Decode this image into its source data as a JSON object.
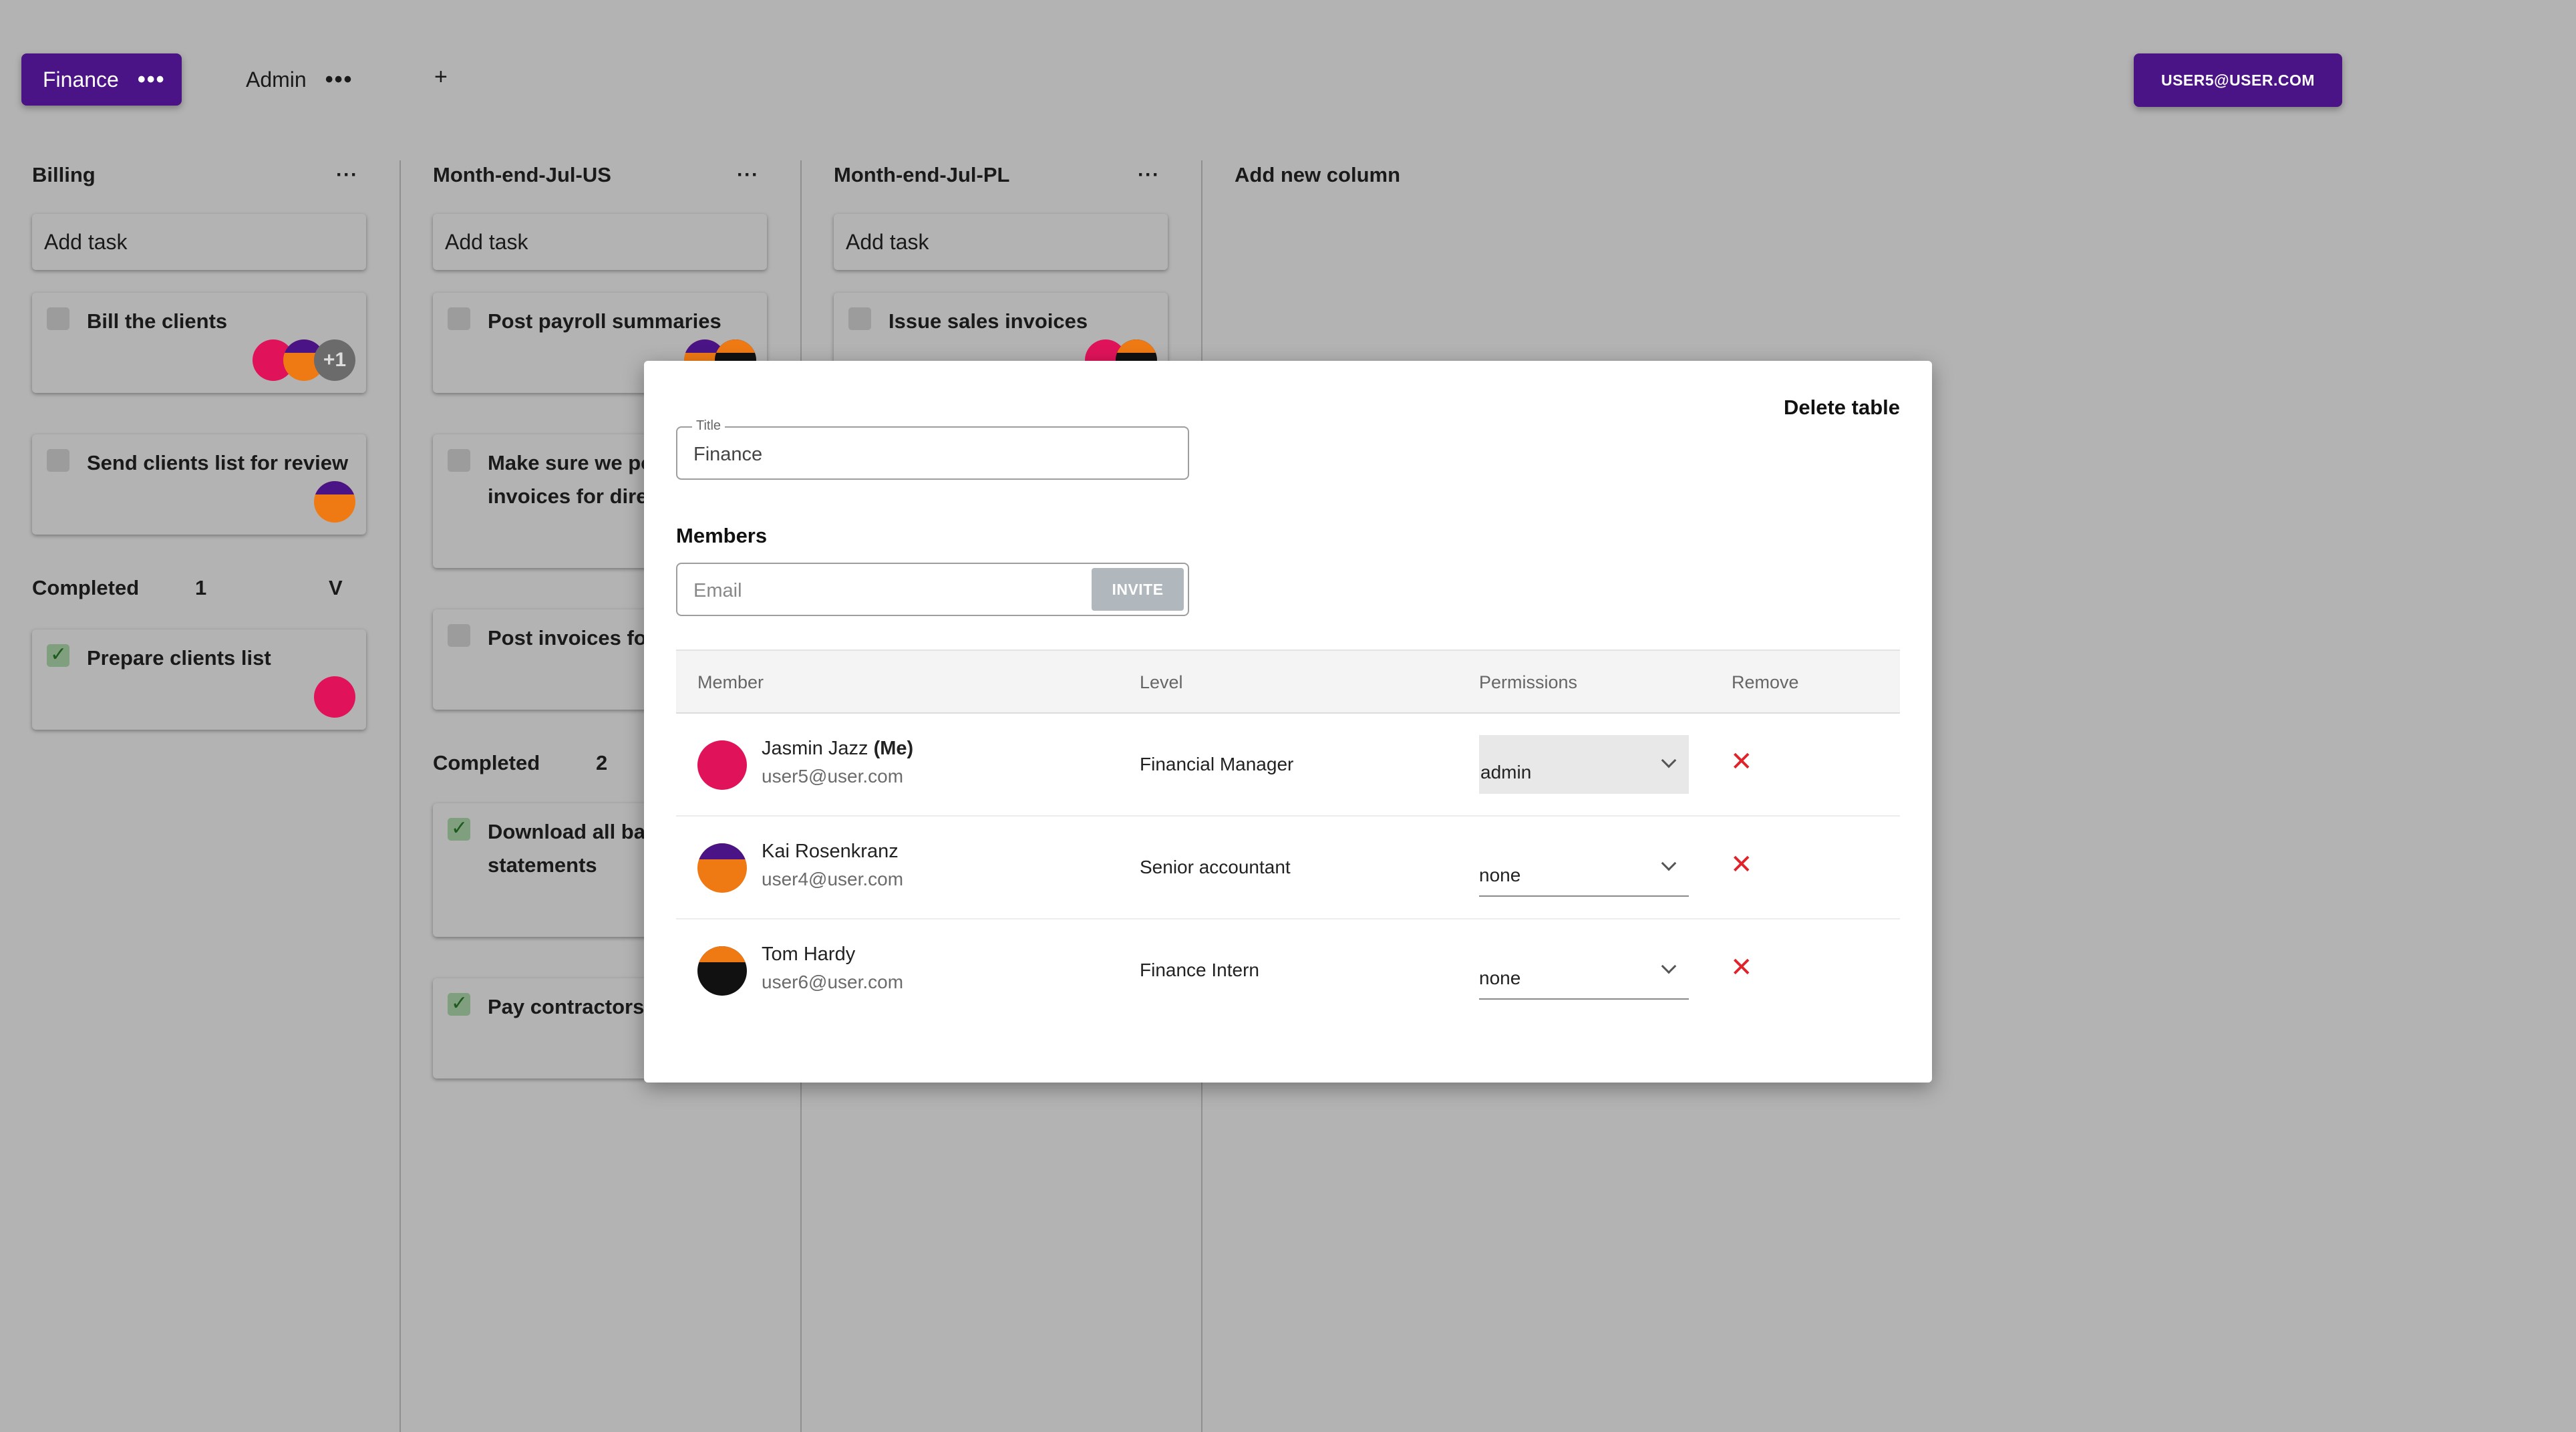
{
  "tabs": [
    {
      "label": "Finance",
      "more": "•••"
    },
    {
      "label": "Admin",
      "more": "•••"
    }
  ],
  "add_tab": "+",
  "user_button": "USER5@USER.COM",
  "columns": [
    {
      "title": "Billing",
      "more": "···",
      "add_task": "Add task",
      "tasks": [
        {
          "title": "Bill the clients",
          "extra_count": "+1"
        },
        {
          "title": "Send clients list for review"
        }
      ],
      "completed": {
        "label": "Completed",
        "count": "1",
        "toggle": "V"
      },
      "completed_tasks": [
        {
          "title": "Prepare clients list"
        }
      ]
    },
    {
      "title": "Month-end-Jul-US",
      "more": "···",
      "add_task": "Add task",
      "tasks": [
        {
          "title": "Post payroll summaries"
        },
        {
          "title": "Make sure we post all invoices for direct debits"
        },
        {
          "title": "Post invoices for"
        }
      ],
      "completed": {
        "label": "Completed",
        "count": "2"
      },
      "completed_tasks": [
        {
          "title": "Download all bank statements"
        },
        {
          "title": "Pay contractors"
        }
      ]
    },
    {
      "title": "Month-end-Jul-PL",
      "more": "···",
      "add_task": "Add task",
      "tasks": [
        {
          "title": "Issue sales invoices"
        }
      ]
    }
  ],
  "add_column": "Add new column",
  "modal": {
    "delete_label": "Delete table",
    "title_legend": "Title",
    "title_value": "Finance",
    "members_label": "Members",
    "email_placeholder": "Email",
    "invite_label": "INVITE",
    "headers": {
      "member": "Member",
      "level": "Level",
      "permissions": "Permissions",
      "remove": "Remove"
    },
    "members": [
      {
        "name": "Jasmin Jazz",
        "me": "(Me)",
        "email": "user5@user.com",
        "level": "Financial Manager",
        "permission": "admin",
        "avatar_color": "#e0135a"
      },
      {
        "name": "Kai Rosenkranz",
        "email": "user4@user.com",
        "level": "Senior accountant",
        "permission": "none",
        "avatar_color": "#ef7a14"
      },
      {
        "name": "Tom Hardy",
        "email": "user6@user.com",
        "level": "Finance Intern",
        "permission": "none",
        "avatar_color": "#111111"
      }
    ],
    "remove_icon": "✕"
  },
  "colors": {
    "brand": "#4a1486",
    "overlay": "#b3b3b3",
    "remove": "#e0232b"
  }
}
